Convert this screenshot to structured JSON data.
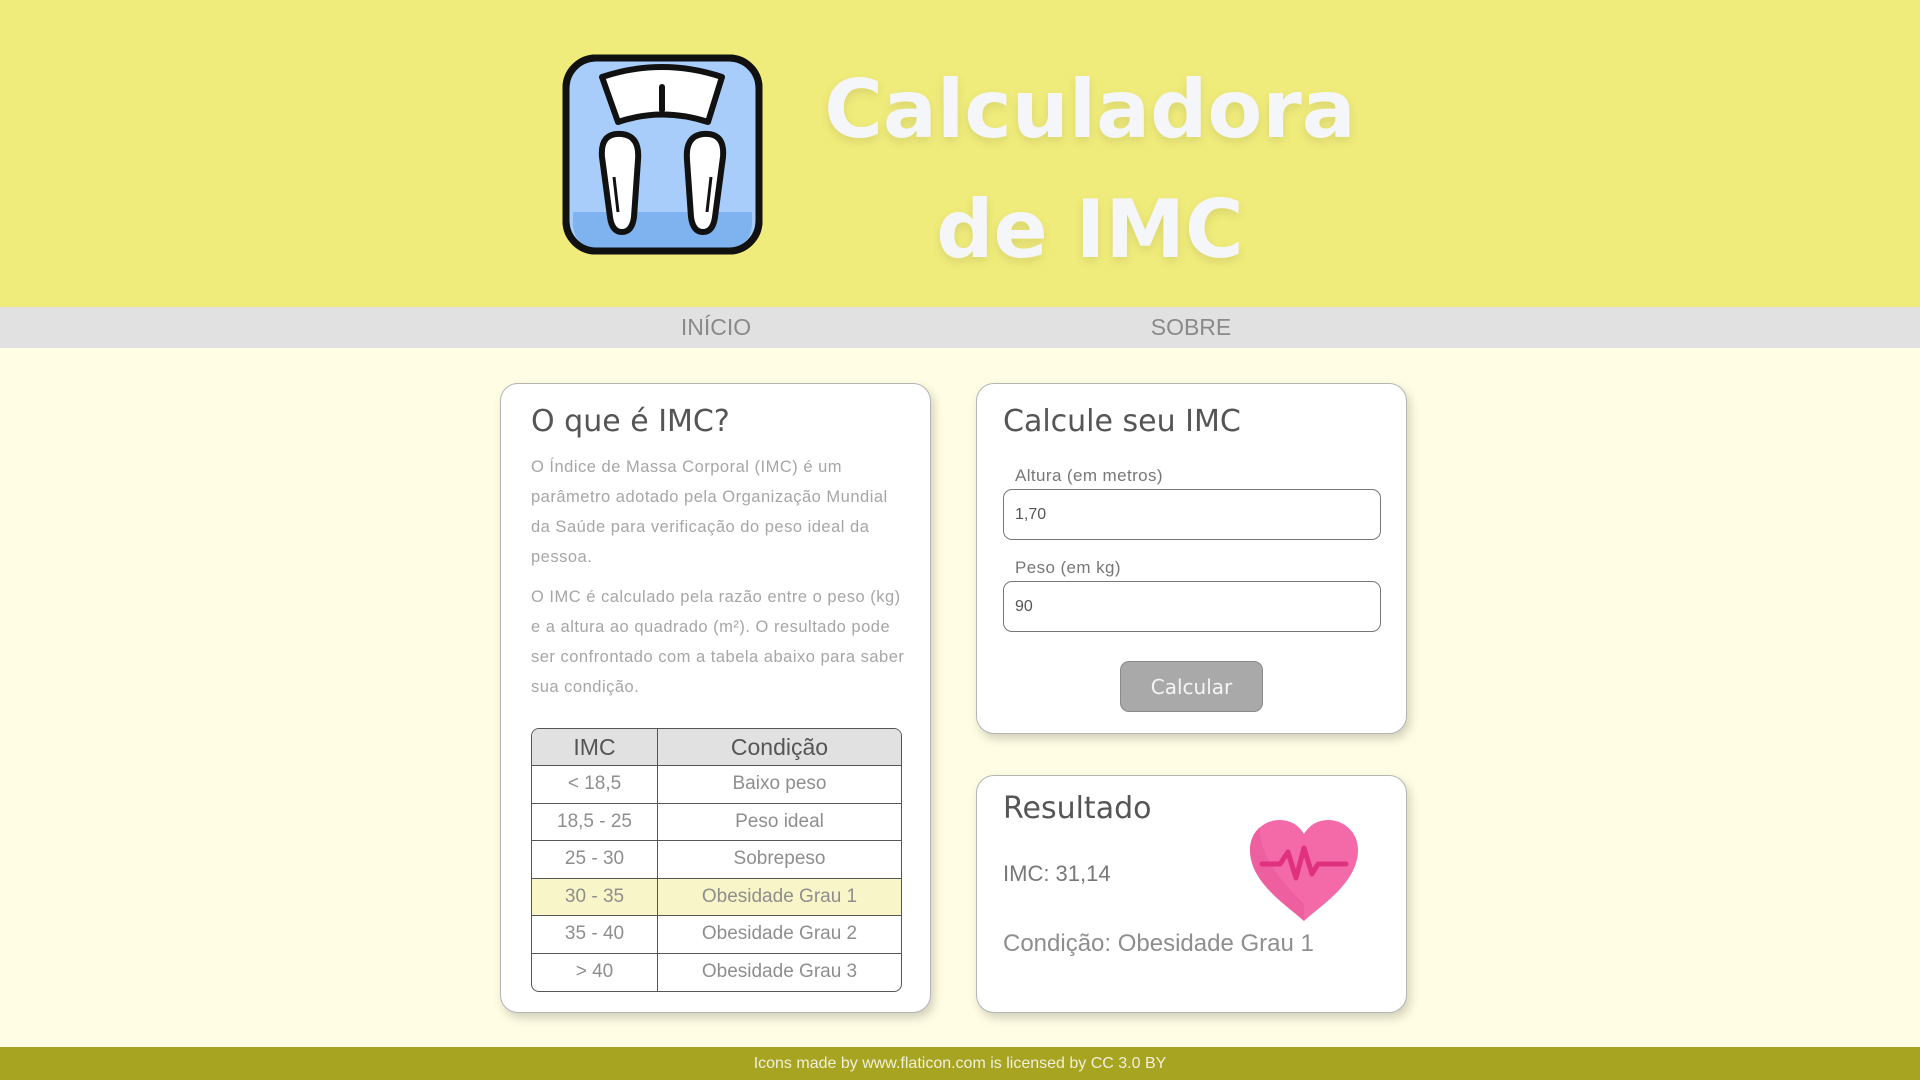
{
  "header": {
    "title_line1": "Calculadora",
    "title_line2": "de IMC",
    "logo_icon": "scale-icon"
  },
  "nav": {
    "items": [
      {
        "label": "INÍCIO"
      },
      {
        "label": "SOBRE"
      }
    ]
  },
  "info": {
    "heading": "O que é IMC?",
    "paragraph1": "O Índice de Massa Corporal (IMC) é um parâmetro adotado pela Organização Mundial da Saúde para verificação do peso ideal da pessoa.",
    "paragraph2": "O IMC é calculado pela razão entre o peso (kg) e a altura ao quadrado (m²). O resultado pode ser confrontado com a tabela abaixo para saber sua condição.",
    "table": {
      "headers": [
        "IMC",
        "Condição"
      ],
      "rows": [
        [
          "< 18,5",
          "Baixo peso"
        ],
        [
          "18,5 - 25",
          "Peso ideal"
        ],
        [
          "25 - 30",
          "Sobrepeso"
        ],
        [
          "30 - 35",
          "Obesidade Grau 1"
        ],
        [
          "35 - 40",
          "Obesidade Grau 2"
        ],
        [
          "> 40",
          "Obesidade Grau 3"
        ]
      ],
      "highlight_row": 3,
      "highlight_color": "#f8f6c8"
    }
  },
  "calc": {
    "heading": "Calcule seu IMC",
    "altura_label": "Altura (em metros)",
    "altura_value": "1,70",
    "peso_label": "Peso (em kg)",
    "peso_value": "90",
    "button_label": "Calcular"
  },
  "result": {
    "heading": "Resultado",
    "imc_text": "IMC: 31,14",
    "condition_text": "Condição: Obesidade Grau 1",
    "icon": "heart-pulse-icon"
  },
  "footer": {
    "text": "Icons made by www.flaticon.com is licensed by CC 3.0 BY"
  },
  "colors": {
    "header_bg": "#f0ec7b",
    "page_bg": "#fffde3",
    "nav_bg": "#e1e1e1",
    "footer_bg": "#a7a422",
    "button_bg": "#a9a9a9"
  }
}
